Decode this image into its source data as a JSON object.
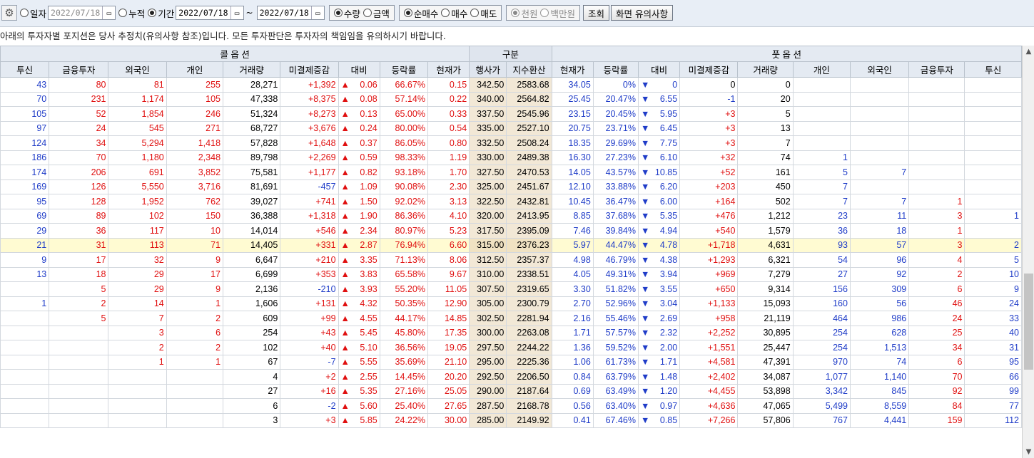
{
  "toolbar": {
    "gear_icon": "gear-icon",
    "mode_day": "일자",
    "day_date": "2022/07/18",
    "mode_cumulative": "누적",
    "mode_period": "기간",
    "period_from": "2022/07/18",
    "period_sep": "~",
    "period_to": "2022/07/18",
    "unit_qty": "수량",
    "unit_amount": "금액",
    "net_buy": "순매수",
    "buy": "매수",
    "sell": "매도",
    "won_thousand": "천원",
    "won_million": "백만원",
    "search_button": "조회",
    "notice_button": "화면 유의사항",
    "selected": {
      "mode": "기간",
      "unit": "수량",
      "side": "순매수",
      "currency": "천원"
    }
  },
  "notice": "아래의 투자자별 포지션은 당사 추정치(유의사항 참조)입니다. 모든 투자판단은 투자자의 책임임을 유의하시기 바랍니다.",
  "header": {
    "call_group": "콜 옵 션",
    "middle_group": "구분",
    "put_group": "풋 옵 션",
    "columns": [
      "투신",
      "금융투자",
      "외국인",
      "개인",
      "거래량",
      "미결제증감",
      "대비",
      "등락률",
      "현재가",
      "행사가",
      "지수환산",
      "현재가",
      "등락률",
      "대비",
      "미결제증감",
      "거래량",
      "개인",
      "외국인",
      "금융투자",
      "투신"
    ]
  },
  "rows": [
    {
      "c": [
        "43",
        "80",
        "81",
        "255",
        "28,271",
        "+1,392",
        "0.06",
        "66.67%",
        "0.15"
      ],
      "m": [
        "342.50",
        "2583.68"
      ],
      "p": [
        "34.05",
        "0%",
        "0",
        "0",
        "0",
        "",
        "",
        "",
        ""
      ]
    },
    {
      "c": [
        "70",
        "231",
        "1,174",
        "105",
        "47,338",
        "+8,375",
        "0.08",
        "57.14%",
        "0.22"
      ],
      "m": [
        "340.00",
        "2564.82"
      ],
      "p": [
        "25.45",
        "20.47%",
        "6.55",
        "-1",
        "20",
        "",
        "",
        "",
        ""
      ]
    },
    {
      "c": [
        "105",
        "52",
        "1,854",
        "246",
        "51,324",
        "+8,273",
        "0.13",
        "65.00%",
        "0.33"
      ],
      "m": [
        "337.50",
        "2545.96"
      ],
      "p": [
        "23.15",
        "20.45%",
        "5.95",
        "+3",
        "5",
        "",
        "",
        "",
        ""
      ]
    },
    {
      "c": [
        "97",
        "24",
        "545",
        "271",
        "68,727",
        "+3,676",
        "0.24",
        "80.00%",
        "0.54"
      ],
      "m": [
        "335.00",
        "2527.10"
      ],
      "p": [
        "20.75",
        "23.71%",
        "6.45",
        "+3",
        "13",
        "",
        "",
        "",
        ""
      ]
    },
    {
      "c": [
        "124",
        "34",
        "5,294",
        "1,418",
        "57,828",
        "+1,648",
        "0.37",
        "86.05%",
        "0.80"
      ],
      "m": [
        "332.50",
        "2508.24"
      ],
      "p": [
        "18.35",
        "29.69%",
        "7.75",
        "+3",
        "7",
        "",
        "",
        "",
        ""
      ]
    },
    {
      "c": [
        "186",
        "70",
        "1,180",
        "2,348",
        "89,798",
        "+2,269",
        "0.59",
        "98.33%",
        "1.19"
      ],
      "m": [
        "330.00",
        "2489.38"
      ],
      "p": [
        "16.30",
        "27.23%",
        "6.10",
        "+32",
        "74",
        "1",
        "",
        "",
        ""
      ]
    },
    {
      "c": [
        "174",
        "206",
        "691",
        "3,852",
        "75,581",
        "+1,177",
        "0.82",
        "93.18%",
        "1.70"
      ],
      "m": [
        "327.50",
        "2470.53"
      ],
      "p": [
        "14.05",
        "43.57%",
        "10.85",
        "+52",
        "161",
        "5",
        "7",
        "",
        ""
      ]
    },
    {
      "c": [
        "169",
        "126",
        "5,550",
        "3,716",
        "81,691",
        "-457",
        "1.09",
        "90.08%",
        "2.30"
      ],
      "m": [
        "325.00",
        "2451.67"
      ],
      "p": [
        "12.10",
        "33.88%",
        "6.20",
        "+203",
        "450",
        "7",
        "",
        "",
        ""
      ]
    },
    {
      "c": [
        "95",
        "128",
        "1,952",
        "762",
        "39,027",
        "+741",
        "1.50",
        "92.02%",
        "3.13"
      ],
      "m": [
        "322.50",
        "2432.81"
      ],
      "p": [
        "10.45",
        "36.47%",
        "6.00",
        "+164",
        "502",
        "7",
        "7",
        "1",
        ""
      ]
    },
    {
      "c": [
        "69",
        "89",
        "102",
        "150",
        "36,388",
        "+1,318",
        "1.90",
        "86.36%",
        "4.10"
      ],
      "m": [
        "320.00",
        "2413.95"
      ],
      "p": [
        "8.85",
        "37.68%",
        "5.35",
        "+476",
        "1,212",
        "23",
        "11",
        "3",
        "1"
      ]
    },
    {
      "c": [
        "29",
        "36",
        "117",
        "10",
        "14,014",
        "+546",
        "2.34",
        "80.97%",
        "5.23"
      ],
      "m": [
        "317.50",
        "2395.09"
      ],
      "p": [
        "7.46",
        "39.84%",
        "4.94",
        "+540",
        "1,579",
        "36",
        "18",
        "1",
        ""
      ]
    },
    {
      "hl": true,
      "c": [
        "21",
        "31",
        "113",
        "71",
        "14,405",
        "+331",
        "2.87",
        "76.94%",
        "6.60"
      ],
      "m": [
        "315.00",
        "2376.23"
      ],
      "p": [
        "5.97",
        "44.47%",
        "4.78",
        "+1,718",
        "4,631",
        "93",
        "57",
        "3",
        "2"
      ]
    },
    {
      "c": [
        "9",
        "17",
        "32",
        "9",
        "6,647",
        "+210",
        "3.35",
        "71.13%",
        "8.06"
      ],
      "m": [
        "312.50",
        "2357.37"
      ],
      "p": [
        "4.98",
        "46.79%",
        "4.38",
        "+1,293",
        "6,321",
        "54",
        "96",
        "4",
        "5"
      ]
    },
    {
      "c": [
        "13",
        "18",
        "29",
        "17",
        "6,699",
        "+353",
        "3.83",
        "65.58%",
        "9.67"
      ],
      "m": [
        "310.00",
        "2338.51"
      ],
      "p": [
        "4.05",
        "49.31%",
        "3.94",
        "+969",
        "7,279",
        "27",
        "92",
        "2",
        "10"
      ]
    },
    {
      "c": [
        "",
        "5",
        "29",
        "9",
        "2,136",
        "-210",
        "3.93",
        "55.20%",
        "11.05"
      ],
      "m": [
        "307.50",
        "2319.65"
      ],
      "p": [
        "3.30",
        "51.82%",
        "3.55",
        "+650",
        "9,314",
        "156",
        "309",
        "6",
        "9"
      ]
    },
    {
      "c": [
        "1",
        "2",
        "14",
        "1",
        "1,606",
        "+131",
        "4.32",
        "50.35%",
        "12.90"
      ],
      "m": [
        "305.00",
        "2300.79"
      ],
      "p": [
        "2.70",
        "52.96%",
        "3.04",
        "+1,133",
        "15,093",
        "160",
        "56",
        "46",
        "24"
      ]
    },
    {
      "c": [
        "",
        "5",
        "7",
        "2",
        "609",
        "+99",
        "4.55",
        "44.17%",
        "14.85"
      ],
      "m": [
        "302.50",
        "2281.94"
      ],
      "p": [
        "2.16",
        "55.46%",
        "2.69",
        "+958",
        "21,119",
        "464",
        "986",
        "24",
        "33"
      ]
    },
    {
      "c": [
        "",
        "",
        "3",
        "6",
        "254",
        "+43",
        "5.45",
        "45.80%",
        "17.35"
      ],
      "m": [
        "300.00",
        "2263.08"
      ],
      "p": [
        "1.71",
        "57.57%",
        "2.32",
        "+2,252",
        "30,895",
        "254",
        "628",
        "25",
        "40"
      ]
    },
    {
      "c": [
        "",
        "",
        "2",
        "2",
        "102",
        "+40",
        "5.10",
        "36.56%",
        "19.05"
      ],
      "m": [
        "297.50",
        "2244.22"
      ],
      "p": [
        "1.36",
        "59.52%",
        "2.00",
        "+1,551",
        "25,447",
        "254",
        "1,513",
        "34",
        "31"
      ]
    },
    {
      "c": [
        "",
        "",
        "1",
        "1",
        "67",
        "-7",
        "5.55",
        "35.69%",
        "21.10"
      ],
      "m": [
        "295.00",
        "2225.36"
      ],
      "p": [
        "1.06",
        "61.73%",
        "1.71",
        "+4,581",
        "47,391",
        "970",
        "74",
        "6",
        "95"
      ]
    },
    {
      "c": [
        "",
        "",
        "",
        "",
        "4",
        "+2",
        "2.55",
        "14.45%",
        "20.20"
      ],
      "m": [
        "292.50",
        "2206.50"
      ],
      "p": [
        "0.84",
        "63.79%",
        "1.48",
        "+2,402",
        "34,087",
        "1,077",
        "1,140",
        "70",
        "66"
      ]
    },
    {
      "c": [
        "",
        "",
        "",
        "",
        "27",
        "+16",
        "5.35",
        "27.16%",
        "25.05"
      ],
      "m": [
        "290.00",
        "2187.64"
      ],
      "p": [
        "0.69",
        "63.49%",
        "1.20",
        "+4,455",
        "53,898",
        "3,342",
        "845",
        "92",
        "99"
      ]
    },
    {
      "c": [
        "",
        "",
        "",
        "",
        "6",
        "-2",
        "5.60",
        "25.40%",
        "27.65"
      ],
      "m": [
        "287.50",
        "2168.78"
      ],
      "p": [
        "0.56",
        "63.40%",
        "0.97",
        "+4,636",
        "47,065",
        "5,499",
        "8,559",
        "84",
        "77"
      ]
    },
    {
      "c": [
        "",
        "",
        "",
        "",
        "3",
        "+3",
        "5.85",
        "24.22%",
        "30.00"
      ],
      "m": [
        "285.00",
        "2149.92"
      ],
      "p": [
        "0.41",
        "67.46%",
        "0.85",
        "+7,266",
        "57,806",
        "767",
        "4,441",
        "159",
        "112"
      ]
    }
  ],
  "colors": {
    "up": "#e01010",
    "down": "#1f3cc8",
    "strike_bg": "#f2e8d6",
    "highlight": "#fffbd2",
    "header_bg": "#e4eaf2"
  }
}
